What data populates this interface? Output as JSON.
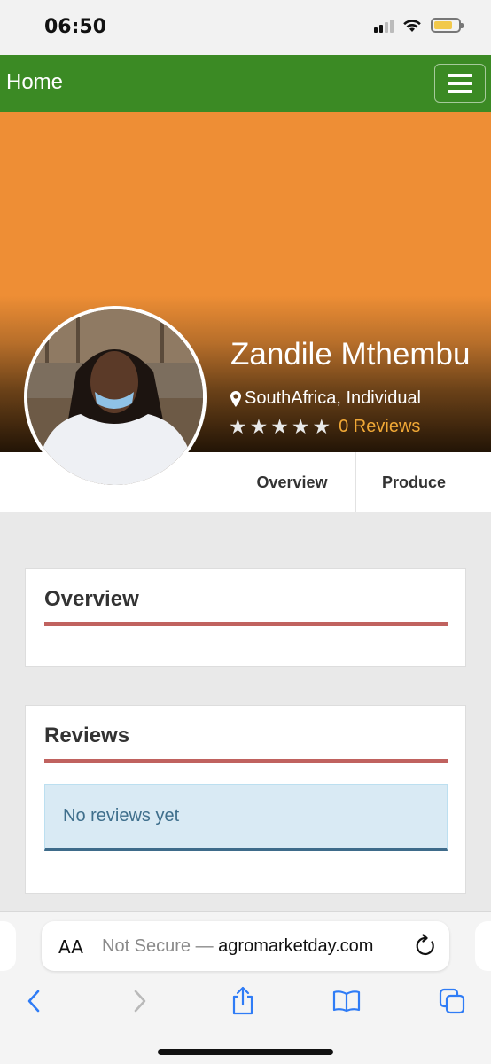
{
  "status_bar": {
    "time": "06:50",
    "battery_level": 0.75
  },
  "navbar": {
    "brand": "Home",
    "menu_icon": "hamburger-icon"
  },
  "profile": {
    "name": "Zandile Mthembu",
    "location": "SouthAfrica, Individual",
    "location_icon": "map-marker-icon",
    "rating": 0,
    "max_rating": 5,
    "reviews_link": "0 Reviews",
    "colors": {
      "cover": "#ee8e35",
      "navbar": "#3b8a24",
      "reviews_link": "#f0a836"
    }
  },
  "tabs": [
    {
      "label": "Overview"
    },
    {
      "label": "Produce"
    }
  ],
  "sections": {
    "overview": {
      "title": "Overview"
    },
    "reviews": {
      "title": "Reviews",
      "empty_message": "No reviews yet"
    }
  },
  "browser": {
    "aa_label": "AA",
    "not_secure": "Not Secure — ",
    "domain": "agromarketday.com",
    "toolbar_icons": [
      "back-icon",
      "forward-icon",
      "share-icon",
      "bookmarks-icon",
      "tabs-icon"
    ]
  }
}
